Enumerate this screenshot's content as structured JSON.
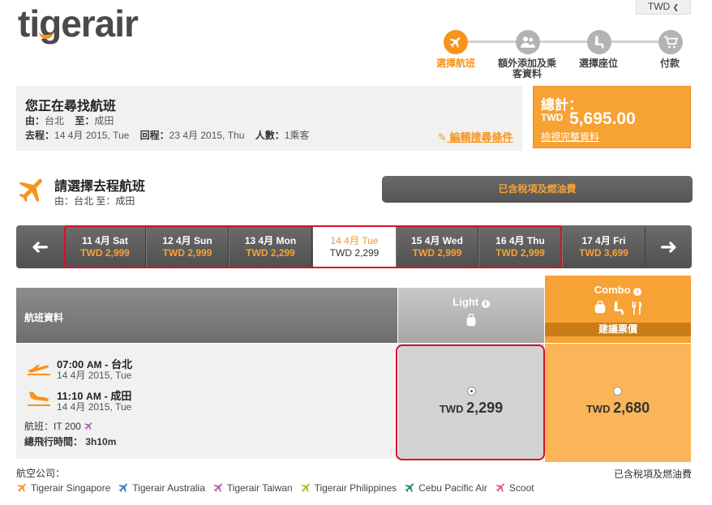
{
  "brand": {
    "logo": "tigerair",
    "accent": "#f7941d"
  },
  "currency": {
    "selected": "TWD"
  },
  "steps": [
    {
      "label": "選擇航班",
      "icon": "plane-icon",
      "active": true
    },
    {
      "label": "額外添加及乘客資料",
      "line1": "額外添加及乘",
      "line2": "客資料",
      "icon": "passengers-icon",
      "active": false
    },
    {
      "label": "選擇座位",
      "icon": "seat-icon",
      "active": false
    },
    {
      "label": "付款",
      "icon": "cart-icon",
      "active": false
    }
  ],
  "search": {
    "title": "您正在尋找航班",
    "from_label": "由：",
    "from": "台北",
    "to_label": "至：",
    "to": "成田",
    "depart_label": "去程：",
    "depart": "14 4月 2015, Tue",
    "return_label": "回程：",
    "return": "23 4月 2015, Thu",
    "pax_label": "人數：",
    "pax": "1乘客",
    "edit": "編輯搜尋條件"
  },
  "total": {
    "label": "總計：",
    "currency": "TWD",
    "amount": "5,695.00",
    "link": "檢視完整資料"
  },
  "departure": {
    "title": "請選擇去程航班",
    "route": "由：台北 至：成田",
    "tax_bar": "已含稅項及燃油費"
  },
  "dates": [
    {
      "date": "11 4月 Sat",
      "price": "TWD 2,999",
      "selected": false
    },
    {
      "date": "12 4月 Sun",
      "price": "TWD 2,999",
      "selected": false
    },
    {
      "date": "13 4月 Mon",
      "price": "TWD 2,299",
      "selected": false
    },
    {
      "date": "14 4月 Tue",
      "price": "TWD 2,299",
      "selected": true
    },
    {
      "date": "15 4月 Wed",
      "price": "TWD 2,999",
      "selected": false
    },
    {
      "date": "16 4月 Thu",
      "price": "TWD 2,999",
      "selected": false
    },
    {
      "date": "17 4月 Fri",
      "price": "TWD 3,699",
      "selected": false
    }
  ],
  "fares": {
    "flight_info_header": "航班資料",
    "light": {
      "name": "Light",
      "currency": "TWD",
      "price": "2,299",
      "selected": true
    },
    "combo": {
      "name": "Combo",
      "badge": "建議票價",
      "currency": "TWD",
      "price": "2,680",
      "selected": false
    }
  },
  "flight": {
    "dep_time": "07:00",
    "dep_ampm": "AM",
    "dep_city": "- 台北",
    "dep_date": "14 4月 2015, Tue",
    "arr_time": "11:10",
    "arr_ampm": "AM",
    "arr_city": "- 成田",
    "arr_date": "14 4月 2015, Tue",
    "flight_label": "航班：",
    "flight_no": "IT 200",
    "duration_label": "總飛行時間：",
    "duration": "3h10m"
  },
  "footer": {
    "airline_label": "航空公司：",
    "tax_note": "已含稅項及燃油費",
    "airlines": [
      {
        "name": "Tigerair Singapore",
        "color": "#f7941d"
      },
      {
        "name": "Tigerair Australia",
        "color": "#2f80c8"
      },
      {
        "name": "Tigerair Taiwan",
        "color": "#b15fb5"
      },
      {
        "name": "Tigerair Philippines",
        "color": "#a4c61a"
      },
      {
        "name": "Cebu Pacific Air",
        "color": "#1c8a6b"
      },
      {
        "name": "Scoot",
        "color": "#e8579a"
      }
    ]
  }
}
